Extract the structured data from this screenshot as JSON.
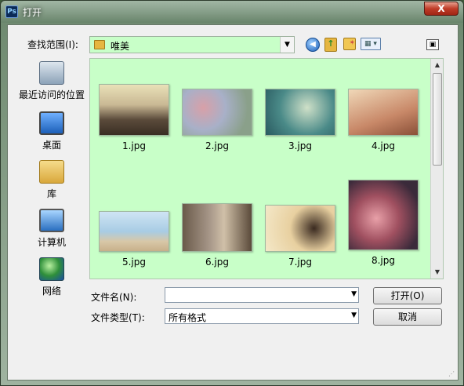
{
  "window": {
    "title": "打开",
    "app_icon_text": "Ps",
    "close_glyph": "X"
  },
  "lookin": {
    "label": "查找范围(I):",
    "value": "唯美"
  },
  "toolbar": {
    "back_icon": "back-arrow-icon",
    "up_icon": "up-folder-icon",
    "new_folder_icon": "new-folder-icon",
    "view_icon": "view-menu-icon"
  },
  "places": [
    {
      "label": "最近访问的位置",
      "icon": "recent-places-icon"
    },
    {
      "label": "桌面",
      "icon": "desktop-icon"
    },
    {
      "label": "库",
      "icon": "libraries-icon"
    },
    {
      "label": "计算机",
      "icon": "computer-icon"
    },
    {
      "label": "网络",
      "icon": "network-icon"
    }
  ],
  "files": [
    {
      "name": "1.jpg"
    },
    {
      "name": "2.jpg"
    },
    {
      "name": "3.jpg"
    },
    {
      "name": "4.jpg"
    },
    {
      "name": "5.jpg"
    },
    {
      "name": "6.jpg"
    },
    {
      "name": "7.jpg"
    },
    {
      "name": "8.jpg"
    }
  ],
  "filename": {
    "label": "文件名(N):",
    "value": ""
  },
  "filetype": {
    "label": "文件类型(T):",
    "value": "所有格式"
  },
  "buttons": {
    "open": "打开(O)",
    "cancel": "取消"
  },
  "colors": {
    "list_background": "#c8ffc8"
  }
}
